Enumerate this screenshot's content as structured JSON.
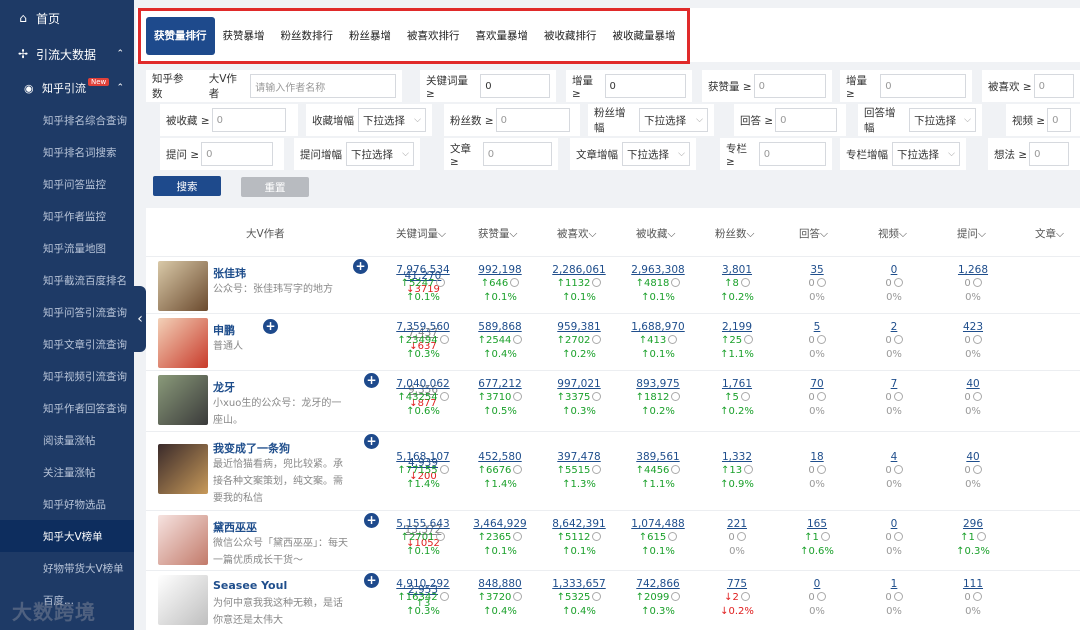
{
  "sidebar": {
    "home": "首页",
    "traffic": "引流大数据",
    "zhihu": "知乎引流",
    "zhihu_badge": "New",
    "items": [
      "知乎排名综合查询",
      "知乎排名词搜索",
      "知乎问答监控",
      "知乎作者监控",
      "知乎流量地图",
      "知乎截流百度排名",
      "知乎问答引流查询",
      "知乎文章引流查询",
      "知乎视频引流查询",
      "知乎作者回答查询",
      "阅读量涨帖",
      "关注量涨帖",
      "知乎好物选品",
      "知乎大V榜单",
      "好物带货大V榜单",
      "百度..."
    ],
    "active_index": 13
  },
  "tabs": [
    "获赞量排行",
    "获赞暴增",
    "粉丝数排行",
    "粉丝暴增",
    "被喜欢排行",
    "喜欢量暴增",
    "被收藏排行",
    "被收藏量暴增"
  ],
  "filters": {
    "section": "知乎参数",
    "author_label": "大V作者",
    "author_placeholder": "请输入作者名称",
    "kw_label": "关键词量 ≥",
    "kw_value": "0",
    "inc_label": "增量 ≥",
    "inc_value": "0",
    "likes_label": "获赞量 ≥",
    "likes_ph": "0",
    "inc2_label": "增量 ≥",
    "inc2_ph": "0",
    "liked_label": "被喜欢 ≥",
    "liked_ph": "0",
    "fav_label": "被收藏 ≥",
    "fav_ph": "0",
    "fav_growth_label": "收藏增幅",
    "select_ph": "下拉选择",
    "fans_label": "粉丝数 ≥",
    "fans_ph": "0",
    "fans_growth_label": "粉丝增幅",
    "answer_label": "回答 ≥",
    "answer_ph": "0",
    "answer_growth_label": "回答增幅",
    "video_label": "视频 ≥",
    "video_ph": "0",
    "question_label": "提问 ≥",
    "question_ph": "0",
    "question_growth_label": "提问增幅",
    "article_label": "文章 ≥",
    "article_ph": "0",
    "article_growth_label": "文章增幅",
    "column_label": "专栏 ≥",
    "column_ph": "0",
    "column_growth_label": "专栏增幅",
    "idea_label": "想法 ≥",
    "idea_ph": "0",
    "search_btn": "搜索",
    "reset_btn": "重置"
  },
  "table": {
    "headers": [
      "大V作者",
      "关键词量⌵",
      "获赞量⌵",
      "被喜欢⌵",
      "被收藏⌵",
      "粉丝数⌵",
      "回答⌵",
      "视频⌵",
      "提问⌵",
      "文章⌵"
    ],
    "rows": [
      {
        "name": "张佳玮",
        "desc": "公众号：张佳玮写字的地方",
        "kw": "41,270",
        "kw_d": "3719",
        "kw_dir": "down",
        "cols": [
          [
            "7,976,534",
            "5247",
            "0.1%",
            "up"
          ],
          [
            "992,198",
            "646",
            "0.1%",
            "up"
          ],
          [
            "2,286,061",
            "1132",
            "0.1%",
            "up"
          ],
          [
            "2,963,308",
            "4818",
            "0.1%",
            "up"
          ],
          [
            "3,801",
            "8",
            "0.2%",
            "up"
          ],
          [
            "35",
            "0",
            "0%",
            "zero"
          ],
          [
            "0",
            "0",
            "0%",
            "zero"
          ],
          [
            "1,268",
            "0",
            "0%",
            "zero"
          ]
        ]
      },
      {
        "name": "申鹏",
        "desc": "普通人",
        "kw": "7,437",
        "kw_d": "637",
        "kw_dir": "down",
        "cols": [
          [
            "7,359,560",
            "23494",
            "0.3%",
            "up"
          ],
          [
            "589,868",
            "2544",
            "0.4%",
            "up"
          ],
          [
            "959,381",
            "2702",
            "0.2%",
            "up"
          ],
          [
            "1,688,970",
            "413",
            "0.1%",
            "up"
          ],
          [
            "2,199",
            "25",
            "1.1%",
            "up"
          ],
          [
            "5",
            "0",
            "0%",
            "zero"
          ],
          [
            "2",
            "0",
            "0%",
            "zero"
          ],
          [
            "423",
            "0",
            "0%",
            "zero"
          ]
        ]
      },
      {
        "name": "龙牙",
        "desc": "小xuo生的公众号：龙牙的一座山。",
        "kw": "9,356",
        "kw_d": "877",
        "kw_dir": "down",
        "cols": [
          [
            "7,040,062",
            "43254",
            "0.6%",
            "up"
          ],
          [
            "677,212",
            "3710",
            "0.5%",
            "up"
          ],
          [
            "997,021",
            "3375",
            "0.3%",
            "up"
          ],
          [
            "893,975",
            "1812",
            "0.2%",
            "up"
          ],
          [
            "1,761",
            "5",
            "0.2%",
            "up"
          ],
          [
            "70",
            "0",
            "0%",
            "zero"
          ],
          [
            "7",
            "0",
            "0%",
            "zero"
          ],
          [
            "40",
            "0",
            "0%",
            "zero"
          ]
        ]
      },
      {
        "name": "我变成了一条狗",
        "desc": "最近恰猫看病，兜比较紧。承接各种文案策划，纯文案。需要我的私信",
        "kw": "4,939",
        "kw_d": "200",
        "kw_dir": "down",
        "cols": [
          [
            "5,168,107",
            "77155",
            "1.4%",
            "up"
          ],
          [
            "452,580",
            "6676",
            "1.4%",
            "up"
          ],
          [
            "397,478",
            "5515",
            "1.3%",
            "up"
          ],
          [
            "389,561",
            "4456",
            "1.1%",
            "up"
          ],
          [
            "1,332",
            "13",
            "0.9%",
            "up"
          ],
          [
            "18",
            "0",
            "0%",
            "zero"
          ],
          [
            "4",
            "0",
            "0%",
            "zero"
          ],
          [
            "40",
            "0",
            "0%",
            "zero"
          ]
        ]
      },
      {
        "name": "黛西巫巫",
        "desc": "微信公众号「黛西巫巫」：每天一篇优质成长干货～",
        "kw": "13,372",
        "kw_d": "1052",
        "kw_dir": "down",
        "cols": [
          [
            "5,155,643",
            "2701",
            "0.1%",
            "up"
          ],
          [
            "3,464,929",
            "2365",
            "0.1%",
            "up"
          ],
          [
            "8,642,391",
            "5112",
            "0.1%",
            "up"
          ],
          [
            "1,074,488",
            "615",
            "0.1%",
            "up"
          ],
          [
            "221",
            "0",
            "0%",
            "zero"
          ],
          [
            "165",
            "1",
            "0.6%",
            "up"
          ],
          [
            "0",
            "0",
            "0%",
            "zero"
          ],
          [
            "296",
            "1",
            "0.3%",
            "up"
          ]
        ]
      },
      {
        "name": "Seasee Youl",
        "desc": "为何中意我我这种无赖，是话你意还是太伟大",
        "kw": "2,953",
        "kw_d": "3",
        "kw_dir": "up",
        "cols": [
          [
            "4,910,292",
            "16342",
            "0.3%",
            "up"
          ],
          [
            "848,880",
            "3720",
            "0.4%",
            "up"
          ],
          [
            "1,333,657",
            "5325",
            "0.4%",
            "up"
          ],
          [
            "742,866",
            "2099",
            "0.3%",
            "up"
          ],
          [
            "775",
            "2",
            "0.2%",
            "down"
          ],
          [
            "0",
            "0",
            "0%",
            "zero"
          ],
          [
            "1",
            "0",
            "0%",
            "zero"
          ],
          [
            "111",
            "0",
            "0%",
            "zero"
          ]
        ]
      }
    ]
  },
  "watermark": "大数跨境",
  "colors": {
    "primary": "#1e4a8c",
    "sidebar": "#1e3a66",
    "up": "#1aa02a",
    "down": "#e02020",
    "highlight": "#e02a2a"
  }
}
